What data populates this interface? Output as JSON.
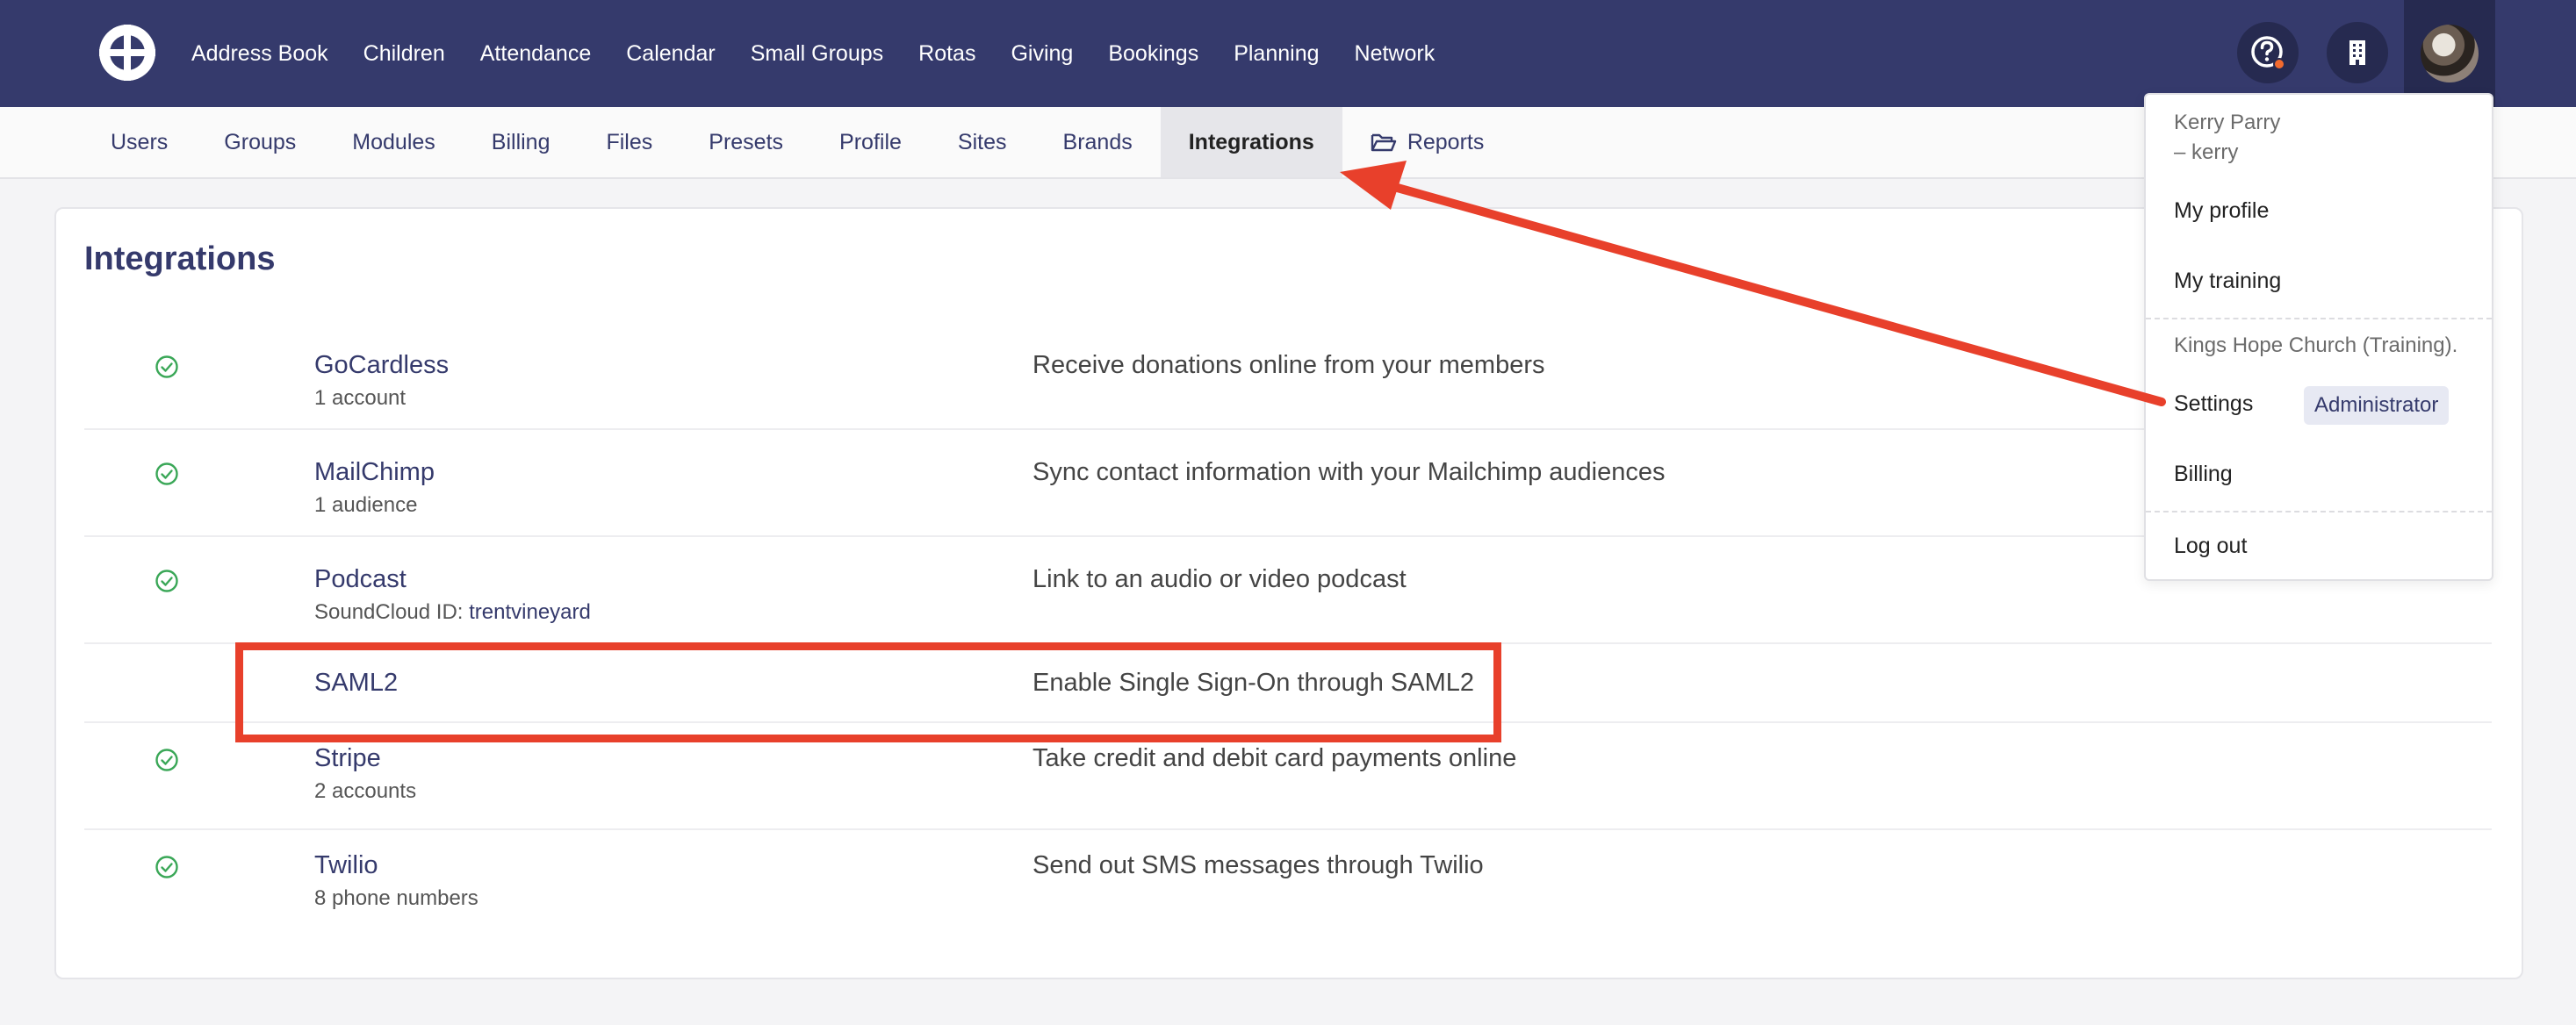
{
  "topnav": {
    "items": [
      "Address Book",
      "Children",
      "Attendance",
      "Calendar",
      "Small Groups",
      "Rotas",
      "Giving",
      "Bookings",
      "Planning",
      "Network"
    ]
  },
  "icons": {
    "logo": "church-logo-icon",
    "help": "help-icon",
    "organisation": "building-icon",
    "avatar": "user-avatar"
  },
  "subnav": {
    "items": [
      "Users",
      "Groups",
      "Modules",
      "Billing",
      "Files",
      "Presets",
      "Profile",
      "Sites",
      "Brands",
      "Integrations"
    ],
    "reports": "Reports",
    "active": "Integrations"
  },
  "page": {
    "title": "Integrations"
  },
  "integrations": [
    {
      "name": "GoCardless",
      "detail": "1 account",
      "description": "Receive donations online from your members",
      "enabled": true
    },
    {
      "name": "MailChimp",
      "detail": "1 audience",
      "description": "Sync contact information with your Mailchimp audiences",
      "enabled": true
    },
    {
      "name": "Podcast",
      "detail_label": "SoundCloud ID:",
      "detail_link": "trentvineyard",
      "description": "Link to an audio or video podcast",
      "enabled": true
    },
    {
      "name": "SAML2",
      "description": "Enable Single Sign-On through SAML2",
      "enabled": false
    },
    {
      "name": "Stripe",
      "detail": "2 accounts",
      "description": "Take credit and debit card payments online",
      "enabled": true
    },
    {
      "name": "Twilio",
      "detail": "8 phone numbers",
      "description": "Send out SMS messages through Twilio",
      "enabled": true
    }
  ],
  "user_menu": {
    "name": "Kerry Parry",
    "username": "– kerry",
    "my_profile": "My profile",
    "my_training": "My training",
    "organisation": "Kings Hope Church (Training).",
    "settings": "Settings",
    "role_badge": "Administrator",
    "billing": "Billing",
    "logout": "Log out"
  },
  "colors": {
    "navbar": "#353a6c",
    "accent": "#353a6c",
    "annotation": "#e8402b",
    "check": "#3aa757"
  }
}
